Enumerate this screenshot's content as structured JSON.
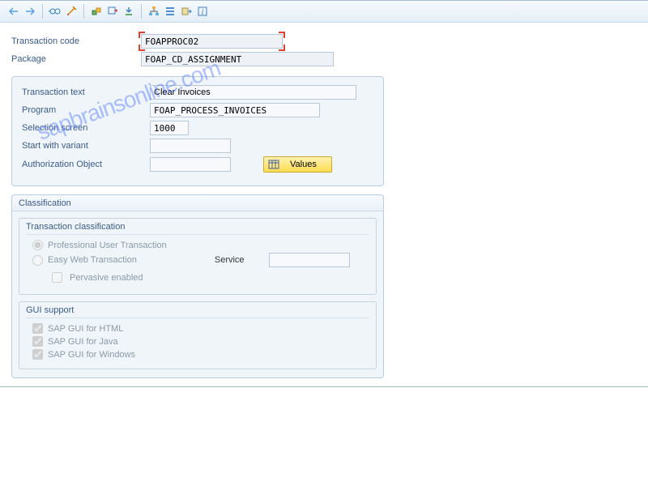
{
  "toolbar": {
    "back": "←",
    "forward": "→",
    "glasses": "👓",
    "wand": "🪄",
    "hier1": "⌂",
    "hier2": "⌂",
    "open": "⇪",
    "tree": "品",
    "bars": "≡",
    "exec": "▶",
    "info": "i"
  },
  "header": {
    "tcode_label": "Transaction code",
    "tcode_value": "FOAPPROC02",
    "package_label": "Package",
    "package_value": "FOAP_CD_ASSIGNMENT"
  },
  "details": {
    "ttext_label": "Transaction text",
    "ttext_value": "Clear Invoices",
    "program_label": "Program",
    "program_value": "FOAP_PROCESS_INVOICES",
    "selscreen_label": "Selection screen",
    "selscreen_value": "1000",
    "variant_label": "Start with variant",
    "variant_value": "",
    "authobj_label": "Authorization Object",
    "authobj_value": "",
    "values_btn": "Values"
  },
  "classification": {
    "title": "Classification",
    "trans_class_title": "Transaction classification",
    "prof_user": "Professional User Transaction",
    "easy_web": "Easy Web Transaction",
    "service_label": "Service",
    "service_value": "",
    "pervasive": "Pervasive enabled",
    "gui_title": "GUI support",
    "gui_html": "SAP GUI for HTML",
    "gui_java": "SAP GUI for Java",
    "gui_win": "SAP GUI for Windows"
  },
  "watermark": "sapbrainsonline.com"
}
